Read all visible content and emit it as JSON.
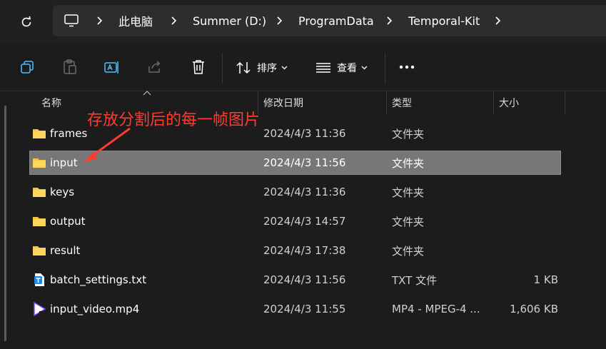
{
  "address": {
    "crumbs": [
      "此电脑",
      "Summer (D:)",
      "ProgramData",
      "Temporal-Kit"
    ]
  },
  "toolbar": {
    "sort_label": "排序",
    "view_label": "查看"
  },
  "columns": {
    "name": "名称",
    "date": "修改日期",
    "type": "类型",
    "size": "大小"
  },
  "files": [
    {
      "name": "frames",
      "date": "2024/4/3 11:36",
      "type": "文件夹",
      "size": "",
      "icon": "folder-icon"
    },
    {
      "name": "input",
      "date": "2024/4/3 11:56",
      "type": "文件夹",
      "size": "",
      "icon": "folder-icon"
    },
    {
      "name": "keys",
      "date": "2024/4/3 11:36",
      "type": "文件夹",
      "size": "",
      "icon": "folder-icon"
    },
    {
      "name": "output",
      "date": "2024/4/3 14:57",
      "type": "文件夹",
      "size": "",
      "icon": "folder-icon"
    },
    {
      "name": "result",
      "date": "2024/4/3 17:38",
      "type": "文件夹",
      "size": "",
      "icon": "folder-icon"
    },
    {
      "name": "batch_settings.txt",
      "date": "2024/4/3 11:56",
      "type": "TXT 文件",
      "size": "1 KB",
      "icon": "text-file-icon"
    },
    {
      "name": "input_video.mp4",
      "date": "2024/4/3 11:55",
      "type": "MP4 - MPEG-4 ...",
      "size": "1,606 KB",
      "icon": "video-file-icon"
    }
  ],
  "annotation": {
    "text": "存放分割后的每一帧图片",
    "color": "#ff3b30"
  },
  "colors": {
    "folder": "#f4c542",
    "selection": "#777777"
  }
}
